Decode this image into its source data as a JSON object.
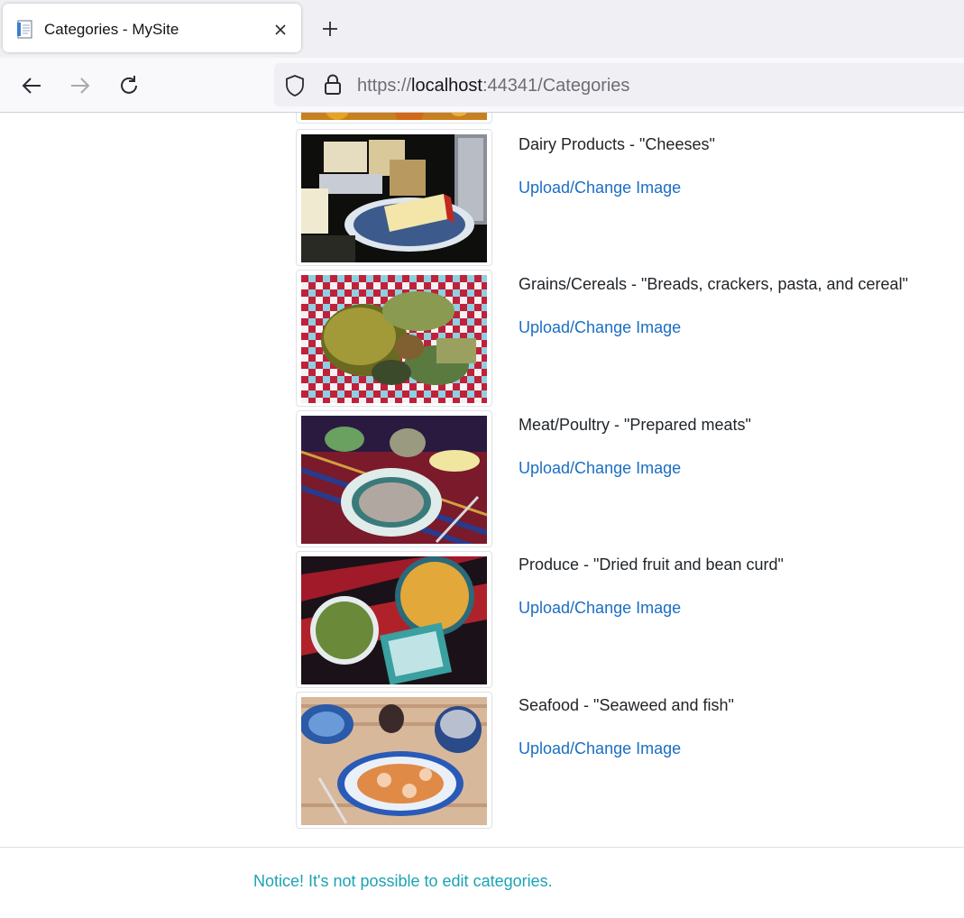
{
  "browser": {
    "tab_title": "Categories - MySite",
    "url_scheme": "https://",
    "url_host": "localhost",
    "url_port_path": ":44341/Categories"
  },
  "categories": [
    {
      "name": "Dairy Products - \"Cheeses\"",
      "action": "Upload/Change Image",
      "image": "cheeses-photo"
    },
    {
      "name": "Grains/Cereals - \"Breads, crackers, pasta, and cereal\"",
      "action": "Upload/Change Image",
      "image": "breads-photo"
    },
    {
      "name": "Meat/Poultry - \"Prepared meats\"",
      "action": "Upload/Change Image",
      "image": "meats-photo"
    },
    {
      "name": "Produce - \"Dried fruit and bean curd\"",
      "action": "Upload/Change Image",
      "image": "produce-photo"
    },
    {
      "name": "Seafood - \"Seaweed and fish\"",
      "action": "Upload/Change Image",
      "image": "seafood-photo"
    }
  ],
  "notice": "Notice! It's not possible to edit categories.",
  "colors": {
    "link": "#1b6ec2",
    "notice": "#1ba3b3",
    "text": "#212529"
  }
}
